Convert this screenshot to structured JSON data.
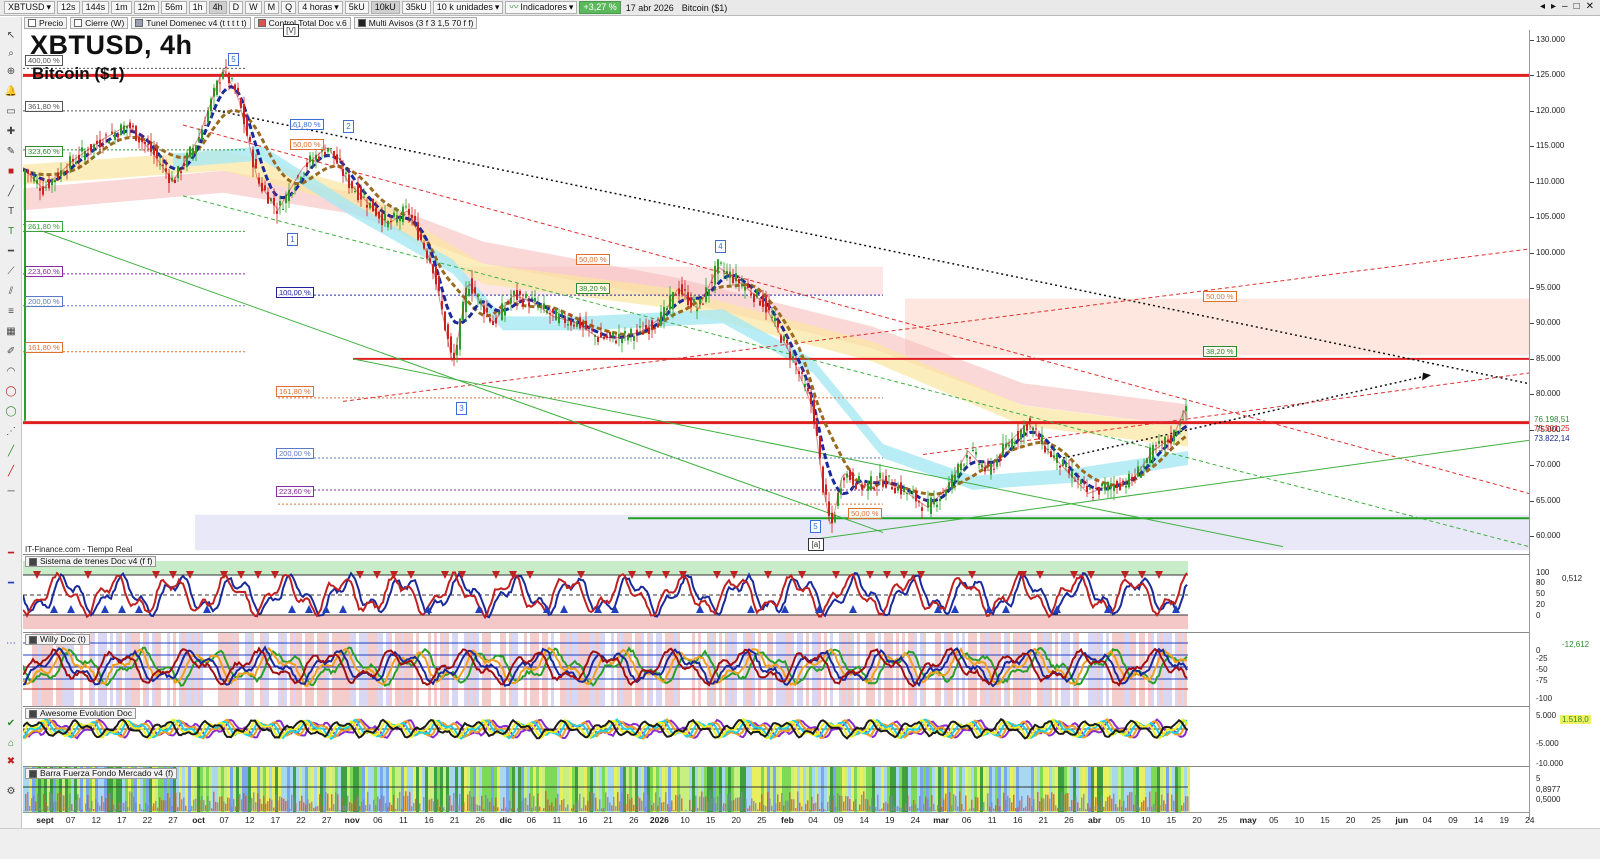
{
  "toolbar": {
    "symbol": "XBTUSD",
    "intervals": [
      "12s",
      "144s",
      "1m",
      "12m",
      "56m",
      "1h",
      "4h",
      "D",
      "W",
      "M",
      "Q"
    ],
    "selected_interval": "4h",
    "period": "4 horas",
    "volume_buttons": [
      "5kU",
      "10kU",
      "35kU"
    ],
    "selected_volume": "10kU",
    "units": "10 k unidades",
    "indicators": "Indicadores",
    "change_pct": "+3,27 %",
    "date": "17 abr 2026",
    "instrument": "Bitcoin ($1)"
  },
  "legend": [
    {
      "label": "Precio",
      "color": "#ffffff"
    },
    {
      "label": "Cierre (W)",
      "color": "#ffffff"
    },
    {
      "label": "Tunel Domenec v4 (t t t t t)",
      "color": "#9aa0b3"
    },
    {
      "label": "Control Total Doc v.6",
      "color": "#e05050"
    },
    {
      "label": "Multi Avisos (3 f 3 1,5 70 f f)",
      "color": "#222222"
    }
  ],
  "chart": {
    "title": "XBTUSD, 4h",
    "subtitle": "Bitcoin ($1)",
    "credit": "IT-Finance.com - Tiempo Real",
    "price_ticks": [
      "130.000",
      "125.000",
      "120.000",
      "115.000",
      "110.000",
      "105.000",
      "100.000",
      "95.000",
      "90.000",
      "85.000",
      "80.000",
      "75.000",
      "70.000",
      "65.000",
      "60.000"
    ],
    "price_tags": [
      {
        "text": "76.198,51",
        "color": "#2e8b2e"
      },
      {
        "text": "75.501,25",
        "color": "#d02020"
      },
      {
        "text": "73.822,14",
        "color": "#1a2a8a"
      }
    ],
    "fib_levels": [
      {
        "text": "400,00 %",
        "color": "#555555"
      },
      {
        "text": "361,80 %",
        "color": "#555555"
      },
      {
        "text": "323,60 %",
        "color": "#2e8b2e"
      },
      {
        "text": "261,80 %",
        "color": "#3aa03a"
      },
      {
        "text": "223,60 %",
        "color": "#8a2aa0"
      },
      {
        "text": "200,00 %",
        "color": "#5a7ac8"
      },
      {
        "text": "161,80 %",
        "color": "#e07030"
      },
      {
        "text": "100,00 %",
        "color": "#2020a0"
      },
      {
        "text": "61,80 %",
        "color": "#3b6fd6"
      },
      {
        "text": "50,00 %",
        "color": "#e07030"
      },
      {
        "text": "38,20 %",
        "color": "#2e8b2e"
      }
    ],
    "wave_labels": [
      "5",
      "2",
      "1",
      "4",
      "3",
      "5",
      "[V]",
      "[a]"
    ]
  },
  "panels": [
    {
      "label": "Sistema de trenes Doc v4 (f f)",
      "ticks": [
        "100",
        "80",
        "50",
        "20",
        "0"
      ],
      "value": "0,512"
    },
    {
      "label": "Willy Doc (t)",
      "ticks": [
        "0",
        "-25",
        "-50",
        "-75",
        "-100"
      ],
      "value": "-12,612"
    },
    {
      "label": "Awesome Evolution Doc",
      "ticks": [
        "5.000",
        "-5.000",
        "-10.000"
      ],
      "value": "1.518,0"
    },
    {
      "label": "Barra Fuerza Fondo Mercado v4 (f)",
      "ticks": [
        "5",
        "0,8977",
        "0,5000"
      ],
      "value": ""
    }
  ],
  "xaxis": [
    {
      "t": "sept",
      "b": true
    },
    {
      "t": "07"
    },
    {
      "t": "12"
    },
    {
      "t": "17"
    },
    {
      "t": "22"
    },
    {
      "t": "27"
    },
    {
      "t": "oct",
      "b": true
    },
    {
      "t": "07"
    },
    {
      "t": "12"
    },
    {
      "t": "17"
    },
    {
      "t": "22"
    },
    {
      "t": "27"
    },
    {
      "t": "nov",
      "b": true
    },
    {
      "t": "06"
    },
    {
      "t": "11"
    },
    {
      "t": "16"
    },
    {
      "t": "21"
    },
    {
      "t": "26"
    },
    {
      "t": "dic",
      "b": true
    },
    {
      "t": "06"
    },
    {
      "t": "11"
    },
    {
      "t": "16"
    },
    {
      "t": "21"
    },
    {
      "t": "26"
    },
    {
      "t": "2026",
      "b": true
    },
    {
      "t": "10"
    },
    {
      "t": "15"
    },
    {
      "t": "20"
    },
    {
      "t": "25"
    },
    {
      "t": "feb",
      "b": true
    },
    {
      "t": "04"
    },
    {
      "t": "09"
    },
    {
      "t": "14"
    },
    {
      "t": "19"
    },
    {
      "t": "24"
    },
    {
      "t": "mar",
      "b": true
    },
    {
      "t": "06"
    },
    {
      "t": "11"
    },
    {
      "t": "16"
    },
    {
      "t": "21"
    },
    {
      "t": "26"
    },
    {
      "t": "abr",
      "b": true
    },
    {
      "t": "05"
    },
    {
      "t": "10"
    },
    {
      "t": "15"
    },
    {
      "t": "20"
    },
    {
      "t": "25"
    },
    {
      "t": "may",
      "b": true
    },
    {
      "t": "05"
    },
    {
      "t": "10"
    },
    {
      "t": "15"
    },
    {
      "t": "20"
    },
    {
      "t": "25"
    },
    {
      "t": "jun",
      "b": true
    },
    {
      "t": "04"
    },
    {
      "t": "09"
    },
    {
      "t": "14"
    },
    {
      "t": "19"
    },
    {
      "t": "24"
    }
  ]
}
